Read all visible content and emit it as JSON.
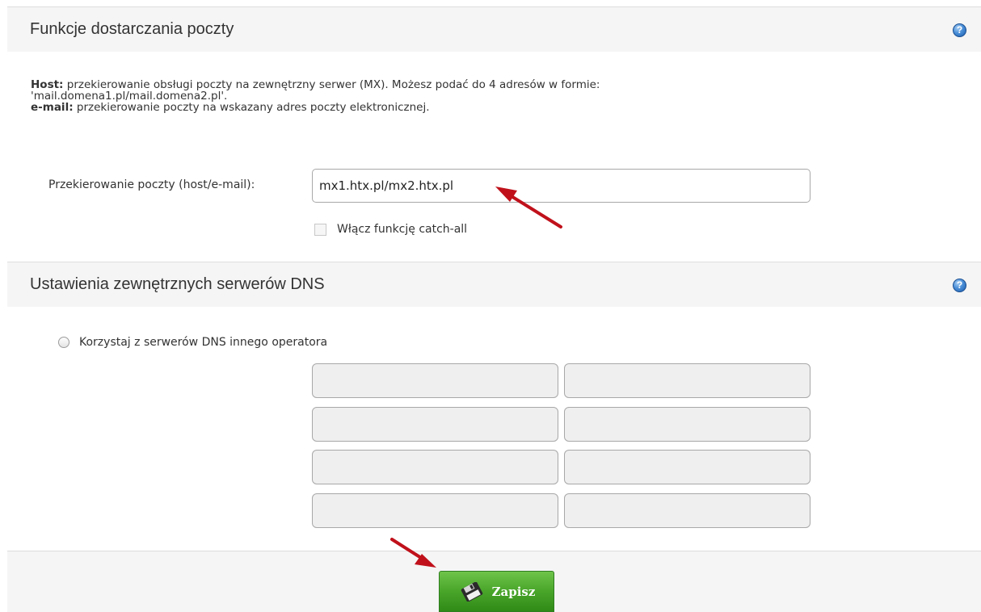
{
  "mail_section": {
    "title": "Funkcje dostarczania poczty",
    "help_icon": "help-icon",
    "info": {
      "host_label": "Host:",
      "host_text": "przekierowanie obsługi poczty na zewnętrzny serwer (MX). Możesz podać do 4 adresów w formie:",
      "host_example": "'mail.domena1.pl/mail.domena2.pl'.",
      "email_label": "e-mail:",
      "email_text": "przekierowanie poczty na wskazany adres poczty elektronicznej."
    },
    "redirect_label": "Przekierowanie poczty (host/e-mail):",
    "redirect_value": "mx1.htx.pl/mx2.htx.pl",
    "catchall_label": "Włącz funkcję catch-all",
    "catchall_checked": false
  },
  "dns_section": {
    "title": "Ustawienia zewnętrznych serwerów DNS",
    "help_icon": "help-icon",
    "radio_label": "Korzystaj z serwerów DNS innego operatora",
    "radio_selected": false,
    "servers": [
      "",
      "",
      "",
      "",
      "",
      "",
      "",
      ""
    ]
  },
  "footer": {
    "save_label": "Zapisz",
    "save_icon": "floppy-disk-icon",
    "button_color": "#48a52a"
  },
  "annotations": {
    "arrow_color": "#c0111b"
  }
}
